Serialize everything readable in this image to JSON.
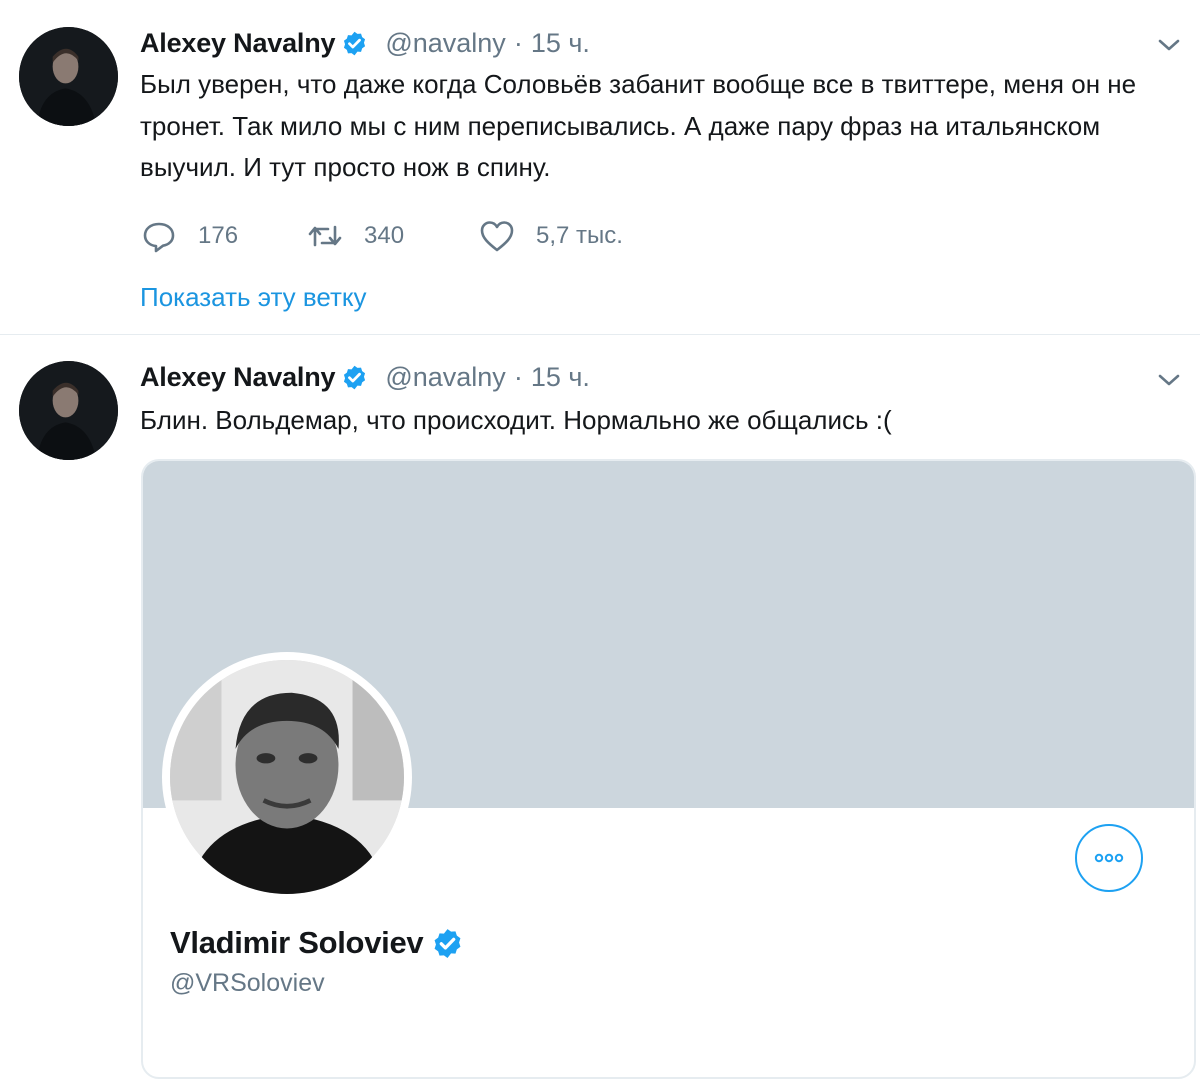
{
  "tweets": [
    {
      "author": {
        "name": "Alexey Navalny",
        "handle": "@navalny",
        "separator": "·",
        "time": "15 ч."
      },
      "text": "Был уверен, что даже когда Соловьёв забанит вообще все в твиттере, меня он не тронет. Так мило мы с ним переписывались. А даже пару фраз на итальянском выучил. И тут просто нож в спину.",
      "actions": {
        "replies": "176",
        "retweets": "340",
        "likes": "5,7 тыс."
      },
      "show_thread": "Показать эту ветку"
    },
    {
      "author": {
        "name": "Alexey Navalny",
        "handle": "@navalny",
        "separator": "·",
        "time": "15 ч."
      },
      "text": "Блин. Вольдемар, что происходит. Нормально же общались :(",
      "card": {
        "name": "Vladimir Soloviev",
        "handle": "@VRSoloviev"
      }
    }
  ],
  "icons": {
    "verified": "verified-badge-icon",
    "caret": "chevron-down-icon",
    "reply": "reply-icon",
    "retweet": "retweet-icon",
    "like": "heart-icon",
    "more": "more-options-icon"
  },
  "colors": {
    "accent": "#1da1f2",
    "link": "#1b95e0",
    "secondary_text": "#657786",
    "banner": "#ccd6dd",
    "divider": "#e6ecf0"
  }
}
